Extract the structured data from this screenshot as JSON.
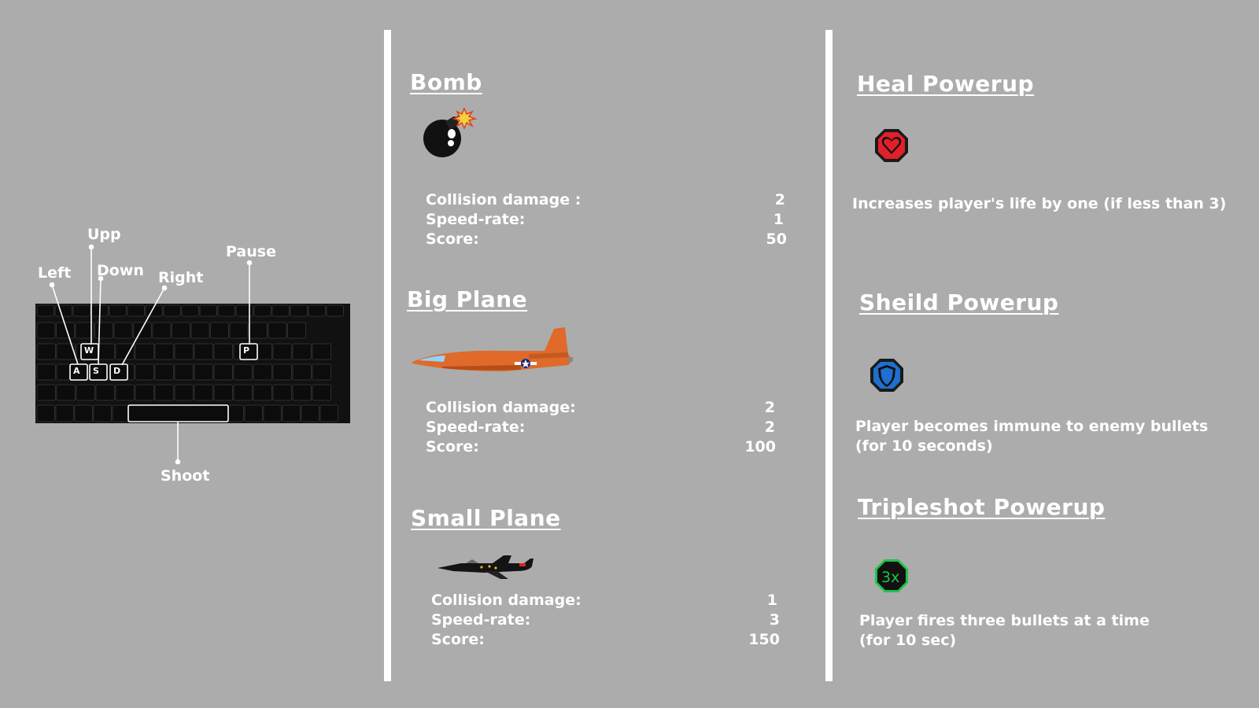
{
  "controls": {
    "labels": {
      "up": "Upp",
      "left": "Left",
      "down": "Down",
      "right": "Right",
      "pause": "Pause",
      "shoot": "Shoot"
    },
    "keys": {
      "w": "W",
      "a": "A",
      "s": "S",
      "d": "D",
      "p": "P"
    }
  },
  "enemies": [
    {
      "title": "Bomb",
      "icon": "bomb-icon",
      "stats": [
        {
          "label": "Collision damage :",
          "value": "2"
        },
        {
          "label": "Speed-rate:",
          "value": "1"
        },
        {
          "label": "Score:",
          "value": "50"
        }
      ]
    },
    {
      "title": "Big Plane",
      "icon": "orange-plane-icon",
      "stats": [
        {
          "label": "Collision damage:",
          "value": "2"
        },
        {
          "label": "Speed-rate:",
          "value": "2"
        },
        {
          "label": "Score:",
          "value": "100"
        }
      ]
    },
    {
      "title": "Small Plane",
      "icon": "jet-fighter-icon",
      "stats": [
        {
          "label": "Collision damage:",
          "value": "1"
        },
        {
          "label": "Speed-rate:",
          "value": "3"
        },
        {
          "label": "Score:",
          "value": "150"
        }
      ]
    }
  ],
  "powerups": [
    {
      "title": "Heal Powerup",
      "icon": "heart-icon",
      "desc_lines": [
        "Increases player's life by one (if less than 3)"
      ]
    },
    {
      "title": "Sheild Powerup",
      "icon": "shield-icon",
      "desc_lines": [
        "Player becomes immune to enemy bullets",
        "(for 10 seconds)"
      ]
    },
    {
      "title": "Tripleshot Powerup",
      "icon": "tripleshot-icon",
      "icon_text": "3x",
      "desc_lines": [
        "Player fires three bullets at a time",
        "(for 10 sec)"
      ]
    }
  ],
  "colors": {
    "background": "#acacac",
    "text": "#ffffff",
    "heart": "#e0202a",
    "shield": "#1e6fd0",
    "tripleshot": "#1fc24a",
    "plane_orange": "#e06a2a"
  }
}
